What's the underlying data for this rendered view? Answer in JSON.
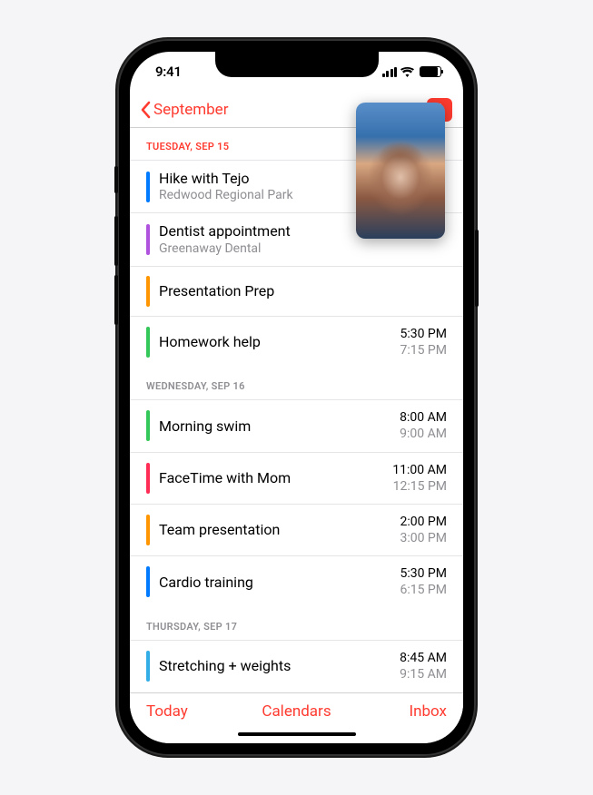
{
  "status": {
    "time": "9:41"
  },
  "nav": {
    "back_label": "September"
  },
  "days": [
    {
      "header": "TUESDAY, SEP 15",
      "is_today": true,
      "events": [
        {
          "title": "Hike with Tejo",
          "subtitle": "Redwood Regional Park",
          "color": "c-blue"
        },
        {
          "title": "Dentist appointment",
          "subtitle": "Greenaway Dental",
          "color": "c-purple"
        },
        {
          "title": "Presentation Prep",
          "color": "c-orange"
        },
        {
          "title": "Homework help",
          "color": "c-green",
          "start": "5:30 PM",
          "end": "7:15 PM"
        }
      ]
    },
    {
      "header": "WEDNESDAY, SEP 16",
      "events": [
        {
          "title": "Morning swim",
          "color": "c-green",
          "start": "8:00 AM",
          "end": "9:00 AM"
        },
        {
          "title": "FaceTime with Mom",
          "color": "c-pink",
          "start": "11:00 AM",
          "end": "12:15 PM"
        },
        {
          "title": "Team presentation",
          "color": "c-orange",
          "start": "2:00 PM",
          "end": "3:00 PM"
        },
        {
          "title": "Cardio training",
          "color": "c-blue",
          "start": "5:30 PM",
          "end": "6:15 PM"
        }
      ]
    },
    {
      "header": "THURSDAY, SEP 17",
      "events": [
        {
          "title": "Stretching + weights",
          "color": "c-cyan",
          "start": "8:45 AM",
          "end": "9:15 AM"
        }
      ]
    }
  ],
  "tabs": {
    "today": "Today",
    "calendars": "Calendars",
    "inbox": "Inbox"
  }
}
